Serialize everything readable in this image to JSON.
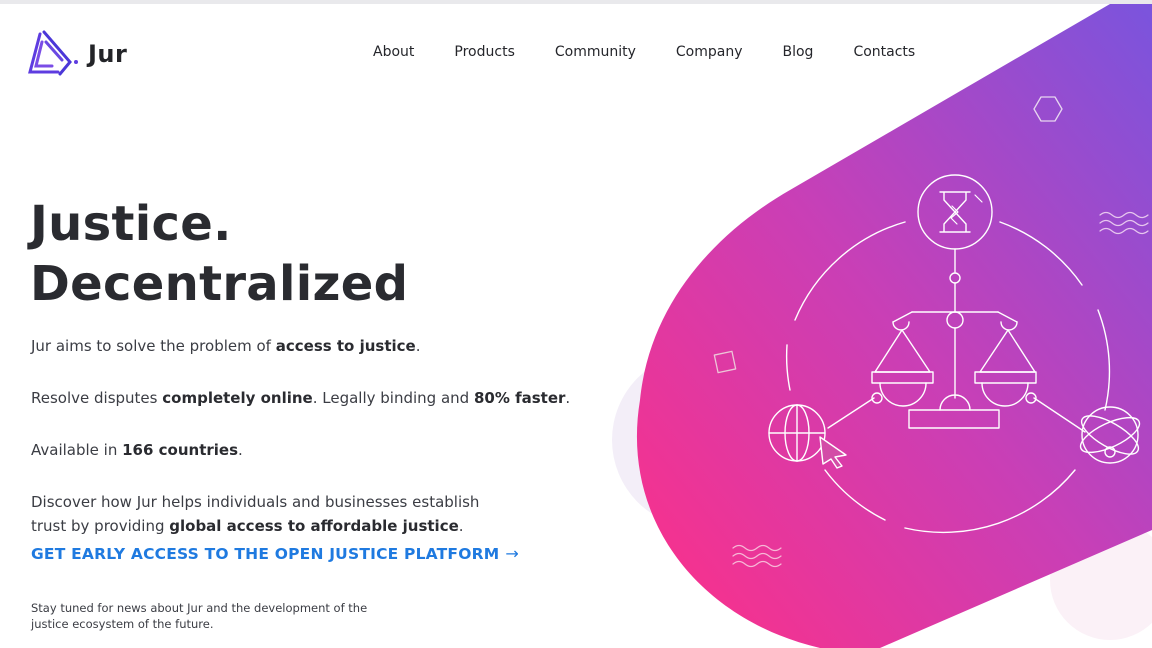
{
  "brand": {
    "name": "Jur",
    "accent": "#1f7ae0",
    "gradient_start": "#ff2f86",
    "gradient_end": "#7a54dd"
  },
  "nav": [
    {
      "label": "About"
    },
    {
      "label": "Products"
    },
    {
      "label": "Community"
    },
    {
      "label": "Company"
    },
    {
      "label": "Blog"
    },
    {
      "label": "Contacts"
    }
  ],
  "hero": {
    "title_line1": "Justice.",
    "title_line2": "Decentralized",
    "p1": {
      "a": "Jur aims to solve the problem of ",
      "b": "access to justice",
      "c": "."
    },
    "p2": {
      "a": "Resolve disputes ",
      "b": "completely online",
      "c": ". Legally binding and ",
      "d": "80% faster",
      "e": "."
    },
    "p3": {
      "a": "Available in ",
      "b": "166 countries",
      "c": "."
    },
    "p4": {
      "a": "Discover how Jur helps individuals and businesses establish trust by providing ",
      "b": "global access to affordable justice",
      "c": "."
    },
    "cta": "GET EARLY ACCESS TO THE OPEN JUSTICE PLATFORM",
    "cta_arrow": "→",
    "note": "Stay tuned for news about Jur and the development of the justice ecosystem of the future."
  },
  "icons": [
    "jur-logo-icon",
    "hourglass-icon",
    "scales-icon",
    "globe-icon",
    "cursor-icon",
    "network-globe-icon",
    "hexagon-icon",
    "square-icon",
    "wave-icon",
    "arrow-right-icon"
  ]
}
